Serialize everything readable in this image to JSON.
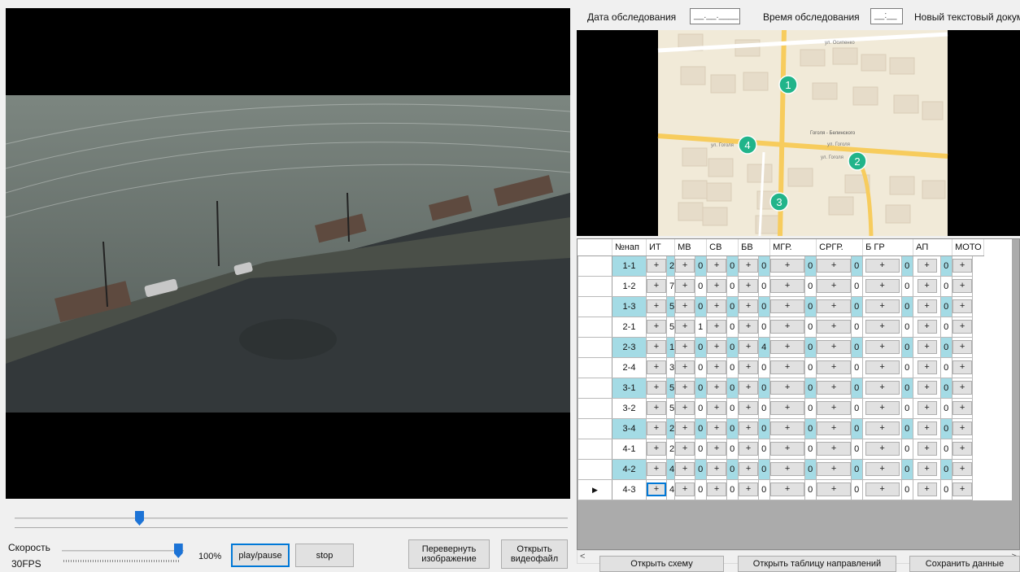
{
  "survey": {
    "date_label": "Дата обследования",
    "date_mask": "__.__.____",
    "time_label": "Время обследования",
    "time_mask": "__:__",
    "doc_label": "Новый текстовый документ"
  },
  "map": {
    "markers": [
      "1",
      "2",
      "3",
      "4"
    ],
    "streets": [
      "ул. Осипенко",
      "ул. Гоголя",
      "ул. Гоголя",
      "ул. Гоголя",
      "Гоголя - Белинского"
    ]
  },
  "player": {
    "seek_position": 0.225,
    "speed_label": "Скорость",
    "speed_value": "100%",
    "speed_level": 0.95,
    "fps_label": "30FPS",
    "play_pause": "play/pause",
    "stop": "stop",
    "flip_image": "Перевернуть изображение",
    "open_video": "Открыть видеофайл"
  },
  "grid": {
    "columns": [
      "№нап",
      "ИТ",
      "",
      "МВ",
      "",
      "СВ",
      "",
      "БВ",
      "",
      "МГР.",
      "",
      "СРГР.",
      "",
      "Б ГР",
      "",
      "АП",
      "",
      "МОТО"
    ],
    "button_label": "+",
    "rows": [
      {
        "dir": "1-1",
        "values": [
          "",
          "2",
          "0",
          "0",
          "0",
          "0",
          "0",
          "0",
          "0",
          "0"
        ],
        "alt": true
      },
      {
        "dir": "1-2",
        "values": [
          "",
          "7",
          "0",
          "0",
          "0",
          "0",
          "0",
          "0",
          "0",
          "0"
        ],
        "alt": false
      },
      {
        "dir": "1-3",
        "values": [
          "",
          "5",
          "0",
          "0",
          "0",
          "0",
          "0",
          "0",
          "0",
          "0"
        ],
        "alt": true
      },
      {
        "dir": "2-1",
        "values": [
          "",
          "5",
          "1",
          "0",
          "0",
          "0",
          "0",
          "0",
          "0",
          "0"
        ],
        "alt": false
      },
      {
        "dir": "2-3",
        "values": [
          "",
          "1",
          "0",
          "0",
          "4",
          "0",
          "0",
          "0",
          "0",
          "0"
        ],
        "alt": true
      },
      {
        "dir": "2-4",
        "values": [
          "",
          "3",
          "0",
          "0",
          "0",
          "0",
          "0",
          "0",
          "0",
          "0"
        ],
        "alt": false
      },
      {
        "dir": "3-1",
        "values": [
          "",
          "5",
          "0",
          "0",
          "0",
          "0",
          "0",
          "0",
          "0",
          "0"
        ],
        "alt": true
      },
      {
        "dir": "3-2",
        "values": [
          "",
          "5",
          "0",
          "0",
          "0",
          "0",
          "0",
          "0",
          "0",
          "0"
        ],
        "alt": false
      },
      {
        "dir": "3-4",
        "values": [
          "",
          "2",
          "0",
          "0",
          "0",
          "0",
          "0",
          "0",
          "0",
          "0"
        ],
        "alt": true
      },
      {
        "dir": "4-1",
        "values": [
          "",
          "2",
          "0",
          "0",
          "0",
          "0",
          "0",
          "0",
          "0",
          "0"
        ],
        "alt": false
      },
      {
        "dir": "4-2",
        "values": [
          "",
          "4",
          "0",
          "0",
          "0",
          "0",
          "0",
          "0",
          "0",
          "0"
        ],
        "alt": true
      },
      {
        "dir": "4-3",
        "values": [
          "",
          "4",
          "0",
          "0",
          "0",
          "0",
          "0",
          "0",
          "0",
          "0"
        ],
        "alt": false,
        "current": true
      }
    ]
  },
  "actions": {
    "open_scheme": "Открыть схему",
    "open_directions": "Открыть таблицу направлений",
    "save_data": "Сохранить данные"
  },
  "colors": {
    "row_highlight": "#a4dbe5",
    "accent": "#0078d7",
    "map_marker": "#21b48a"
  },
  "icons": [
    "row-pointer-icon",
    "scroll-left-icon",
    "scroll-right-icon"
  ]
}
